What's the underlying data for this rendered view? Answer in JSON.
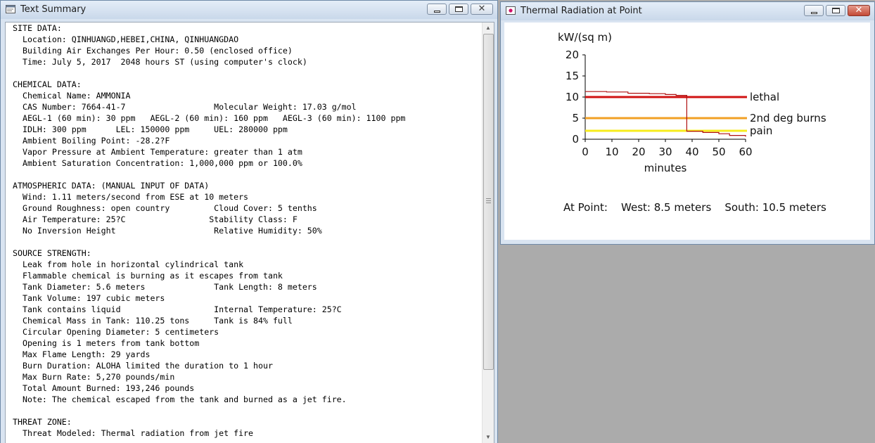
{
  "text_window": {
    "title": "Text Summary",
    "lines": [
      "SITE DATA:",
      "  Location: QINHUANGD,HEBEI,CHINA, QINHUANGDAO",
      "  Building Air Exchanges Per Hour: 0.50 (enclosed office)",
      "  Time: July 5, 2017  2048 hours ST (using computer's clock)",
      "",
      "CHEMICAL DATA:",
      "  Chemical Name: AMMONIA",
      "  CAS Number: 7664-41-7                  Molecular Weight: 17.03 g/mol",
      "  AEGL-1 (60 min): 30 ppm   AEGL-2 (60 min): 160 ppm   AEGL-3 (60 min): 1100 ppm",
      "  IDLH: 300 ppm      LEL: 150000 ppm     UEL: 280000 ppm",
      "  Ambient Boiling Point: -28.2?F",
      "  Vapor Pressure at Ambient Temperature: greater than 1 atm",
      "  Ambient Saturation Concentration: 1,000,000 ppm or 100.0%",
      "",
      "ATMOSPHERIC DATA: (MANUAL INPUT OF DATA)",
      "  Wind: 1.11 meters/second from ESE at 10 meters",
      "  Ground Roughness: open country         Cloud Cover: 5 tenths",
      "  Air Temperature: 25?C                 Stability Class: F",
      "  No Inversion Height                    Relative Humidity: 50%",
      "",
      "SOURCE STRENGTH:",
      "  Leak from hole in horizontal cylindrical tank",
      "  Flammable chemical is burning as it escapes from tank",
      "  Tank Diameter: 5.6 meters              Tank Length: 8 meters",
      "  Tank Volume: 197 cubic meters",
      "  Tank contains liquid                   Internal Temperature: 25?C",
      "  Chemical Mass in Tank: 110.25 tons     Tank is 84% full",
      "  Circular Opening Diameter: 5 centimeters",
      "  Opening is 1 meters from tank bottom",
      "  Max Flame Length: 29 yards",
      "  Burn Duration: ALOHA limited the duration to 1 hour",
      "  Max Burn Rate: 5,270 pounds/min",
      "  Total Amount Burned: 193,246 pounds",
      "  Note: The chemical escaped from the tank and burned as a jet fire.",
      "",
      "THREAT ZONE:",
      "  Threat Modeled: Thermal radiation from jet fire"
    ]
  },
  "chart_window": {
    "title": "Thermal Radiation at Point",
    "at_point": "At Point:    West: 8.5 meters    South: 10.5 meters"
  },
  "chart_data": {
    "type": "line",
    "ylabel": "kW/(sq m)",
    "xlabel": "minutes",
    "xlim": [
      0,
      60
    ],
    "ylim": [
      0,
      20
    ],
    "xticks": [
      0,
      10,
      20,
      30,
      40,
      50,
      60
    ],
    "yticks": [
      0,
      5,
      10,
      15,
      20
    ],
    "series": [
      {
        "color": "#b01010",
        "step": true,
        "points": [
          [
            0,
            11.3
          ],
          [
            8,
            11.2
          ],
          [
            16,
            10.9
          ],
          [
            24,
            10.8
          ],
          [
            30,
            10.6
          ],
          [
            34,
            10.4
          ],
          [
            38,
            10.1
          ],
          [
            38,
            1.9
          ],
          [
            44,
            1.6
          ],
          [
            50,
            1.3
          ],
          [
            54,
            0.9
          ],
          [
            60,
            0.6
          ]
        ]
      }
    ],
    "thresholds": [
      {
        "label": "lethal",
        "value": 10,
        "color": "#d01212"
      },
      {
        "label": "2nd deg burns",
        "value": 5,
        "color": "#f2a024"
      },
      {
        "label": "pain",
        "value": 2,
        "color": "#f7ec1c"
      }
    ]
  },
  "colors": {
    "desktop": "#ababab",
    "frame": "#d9e4f1",
    "close_red": "#c34a36"
  }
}
